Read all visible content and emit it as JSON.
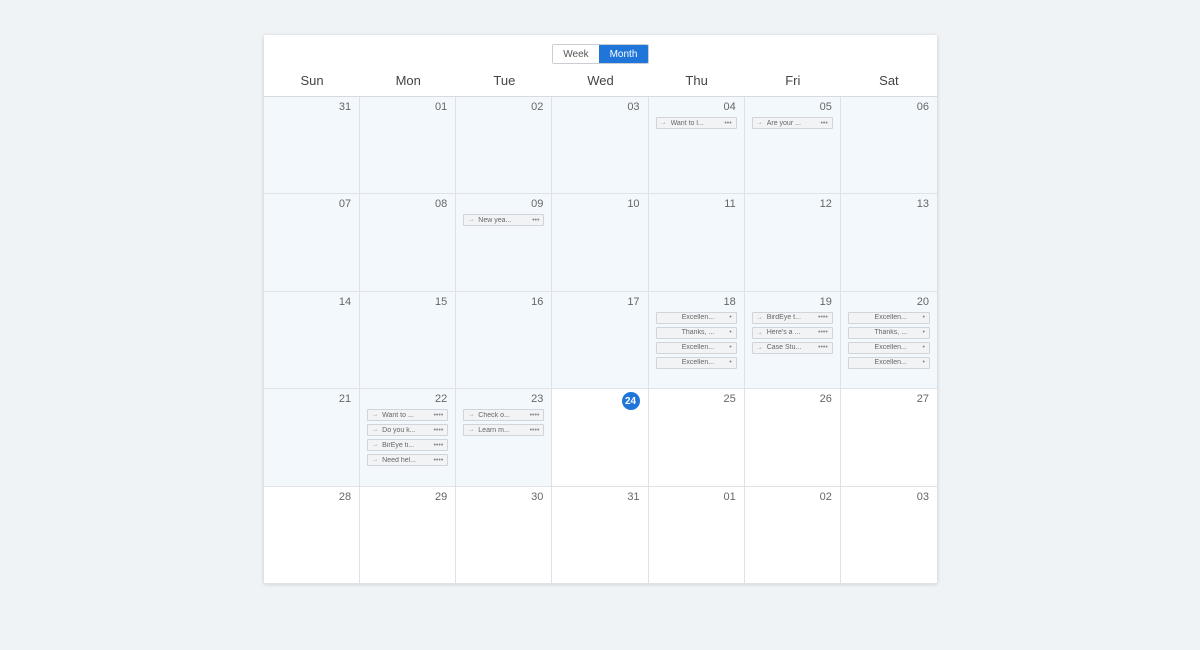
{
  "view_toggle": {
    "week": "Week",
    "month": "Month",
    "active": "Month"
  },
  "weekdays": [
    "Sun",
    "Mon",
    "Tue",
    "Wed",
    "Thu",
    "Fri",
    "Sat"
  ],
  "today": "24",
  "weeks": [
    [
      {
        "num": "31",
        "past": true,
        "events": []
      },
      {
        "num": "01",
        "past": true,
        "events": []
      },
      {
        "num": "02",
        "past": true,
        "events": []
      },
      {
        "num": "03",
        "past": true,
        "events": []
      },
      {
        "num": "04",
        "past": true,
        "events": [
          {
            "title": "Want to l...",
            "icon": "social",
            "dots": "•••"
          }
        ]
      },
      {
        "num": "05",
        "past": true,
        "events": [
          {
            "title": "Are your ...",
            "icon": "social",
            "dots": "•••"
          }
        ]
      },
      {
        "num": "06",
        "past": true,
        "events": []
      }
    ],
    [
      {
        "num": "07",
        "past": true,
        "events": []
      },
      {
        "num": "08",
        "past": true,
        "events": []
      },
      {
        "num": "09",
        "past": true,
        "events": [
          {
            "title": "New yea...",
            "icon": "social",
            "dots": "•••"
          }
        ]
      },
      {
        "num": "10",
        "past": true,
        "events": []
      },
      {
        "num": "11",
        "past": true,
        "events": []
      },
      {
        "num": "12",
        "past": true,
        "events": []
      },
      {
        "num": "13",
        "past": true,
        "events": []
      }
    ],
    [
      {
        "num": "14",
        "past": true,
        "events": []
      },
      {
        "num": "15",
        "past": true,
        "events": []
      },
      {
        "num": "16",
        "past": true,
        "events": []
      },
      {
        "num": "17",
        "past": true,
        "events": []
      },
      {
        "num": "18",
        "past": true,
        "events": [
          {
            "title": "Excellen...",
            "icon": "",
            "dots": "•"
          },
          {
            "title": "Thanks, ...",
            "icon": "",
            "dots": "•"
          },
          {
            "title": "Excellen...",
            "icon": "",
            "dots": "•"
          },
          {
            "title": "Excellen...",
            "icon": "",
            "dots": "•"
          }
        ]
      },
      {
        "num": "19",
        "past": true,
        "events": [
          {
            "title": "BirdEye t...",
            "icon": "social",
            "dots": "••••"
          },
          {
            "title": "Here's a ...",
            "icon": "social",
            "dots": "••••"
          },
          {
            "title": "Case Stu...",
            "icon": "social",
            "dots": "••••"
          }
        ]
      },
      {
        "num": "20",
        "past": true,
        "events": [
          {
            "title": "Excellen...",
            "icon": "",
            "dots": "•"
          },
          {
            "title": "Thanks, ...",
            "icon": "",
            "dots": "•"
          },
          {
            "title": "Excellen...",
            "icon": "",
            "dots": "•"
          },
          {
            "title": "Excellen...",
            "icon": "",
            "dots": "•"
          }
        ]
      }
    ],
    [
      {
        "num": "21",
        "past": true,
        "events": []
      },
      {
        "num": "22",
        "past": true,
        "events": [
          {
            "title": "Want to ...",
            "icon": "social",
            "dots": "••••"
          },
          {
            "title": "Do you k...",
            "icon": "social",
            "dots": "••••"
          },
          {
            "title": "BirEye ti...",
            "icon": "social",
            "dots": "••••"
          },
          {
            "title": "Need hel...",
            "icon": "social",
            "dots": "••••"
          }
        ]
      },
      {
        "num": "23",
        "past": true,
        "events": [
          {
            "title": "Check o...",
            "icon": "social",
            "dots": "••••"
          },
          {
            "title": "Learn m...",
            "icon": "social",
            "dots": "••••"
          }
        ]
      },
      {
        "num": "24",
        "past": false,
        "today": true,
        "events": []
      },
      {
        "num": "25",
        "past": false,
        "events": []
      },
      {
        "num": "26",
        "past": false,
        "events": []
      },
      {
        "num": "27",
        "past": false,
        "events": []
      }
    ],
    [
      {
        "num": "28",
        "past": false,
        "events": []
      },
      {
        "num": "29",
        "past": false,
        "events": []
      },
      {
        "num": "30",
        "past": false,
        "events": []
      },
      {
        "num": "31",
        "past": false,
        "events": []
      },
      {
        "num": "01",
        "past": false,
        "events": []
      },
      {
        "num": "02",
        "past": false,
        "events": []
      },
      {
        "num": "03",
        "past": false,
        "events": []
      }
    ]
  ]
}
